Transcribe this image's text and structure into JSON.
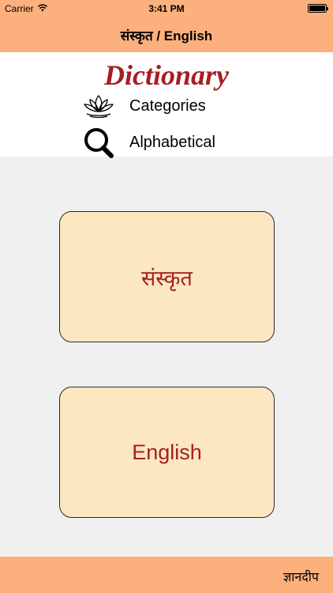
{
  "status_bar": {
    "carrier": "Carrier",
    "time": "3:41 PM",
    "icons": [
      "wifi-icon",
      "battery-icon"
    ]
  },
  "nav": {
    "title": "संस्कृत / English"
  },
  "header": {
    "title": "Dictionary",
    "menu": [
      {
        "label": "Categories",
        "icon": "lotus-icon"
      },
      {
        "label": "Alphabetical",
        "icon": "magnifier-icon"
      }
    ]
  },
  "cards": {
    "sanskrit_label": "संस्कृत",
    "english_label": "English"
  },
  "footer": {
    "brand": "ज्ञानदीप"
  },
  "colors": {
    "bar_background": "#fbb07d",
    "card_background": "#fce8c0",
    "accent_red": "#a61e22",
    "page_background": "#f0f0f0"
  }
}
